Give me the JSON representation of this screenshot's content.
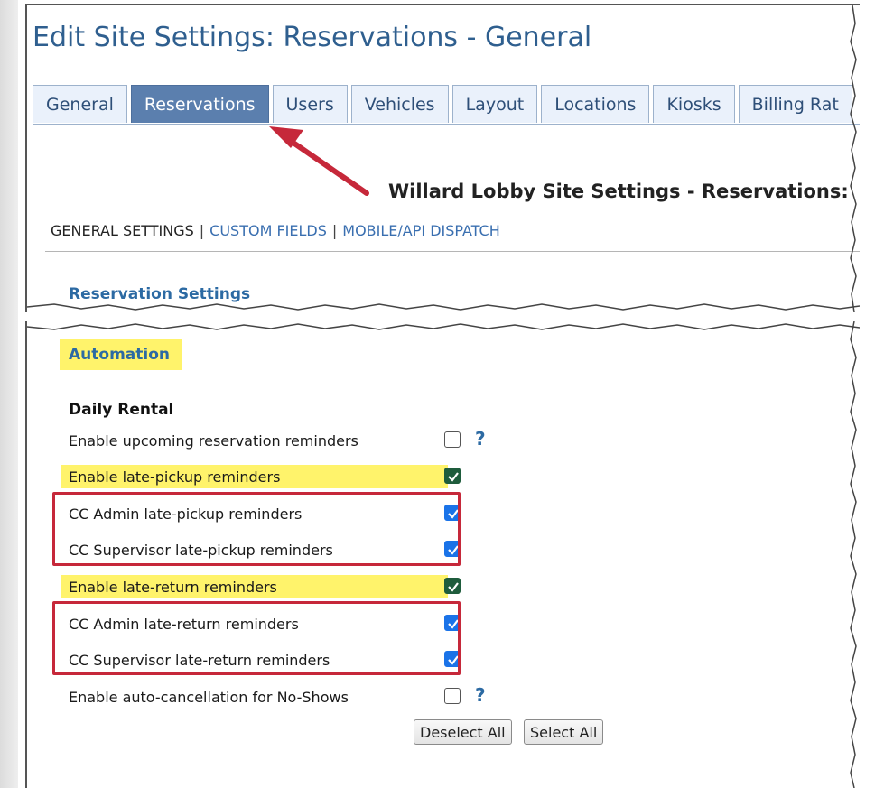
{
  "page": {
    "heading": "Edit Site Settings: Reservations - General"
  },
  "tabs": [
    {
      "label": "General",
      "active": false
    },
    {
      "label": "Reservations",
      "active": true
    },
    {
      "label": "Users",
      "active": false
    },
    {
      "label": "Vehicles",
      "active": false
    },
    {
      "label": "Layout",
      "active": false
    },
    {
      "label": "Locations",
      "active": false
    },
    {
      "label": "Kiosks",
      "active": false
    },
    {
      "label": "Billing Rat",
      "active": false
    }
  ],
  "content": {
    "site_title": "Willard Lobby Site Settings - Reservations:",
    "subnav": {
      "current": "GENERAL SETTINGS",
      "separator": "|",
      "links": [
        "CUSTOM FIELDS",
        "MOBILE/API DISPATCH"
      ]
    },
    "section_link": "Reservation Settings"
  },
  "automation": {
    "heading": "Automation",
    "group_title": "Daily Rental",
    "rows": [
      {
        "label": "Enable upcoming reservation reminders",
        "checked": false,
        "help": "?"
      },
      {
        "label": "Enable late-pickup reminders",
        "checked": true
      },
      {
        "label": "CC Admin late-pickup reminders",
        "checked": true
      },
      {
        "label": "CC Supervisor late-pickup reminders",
        "checked": true
      },
      {
        "label": "Enable late-return reminders",
        "checked": true
      },
      {
        "label": "CC Admin late-return reminders",
        "checked": true
      },
      {
        "label": "CC Supervisor late-return reminders",
        "checked": true
      },
      {
        "label": "Enable auto-cancellation for No-Shows",
        "checked": false,
        "help": "?"
      }
    ],
    "buttons": {
      "deselect_all": "Deselect All",
      "select_all": "Select All"
    }
  },
  "colors": {
    "heading_blue": "#2f5f8f",
    "active_tab": "#5b7fae",
    "link_blue": "#2c6aa3",
    "highlight_yellow": "#fff36b",
    "annotation_red": "#c6283a",
    "checkbox_blue": "#1a73e8",
    "checkbox_green": "#1e5c3c"
  }
}
